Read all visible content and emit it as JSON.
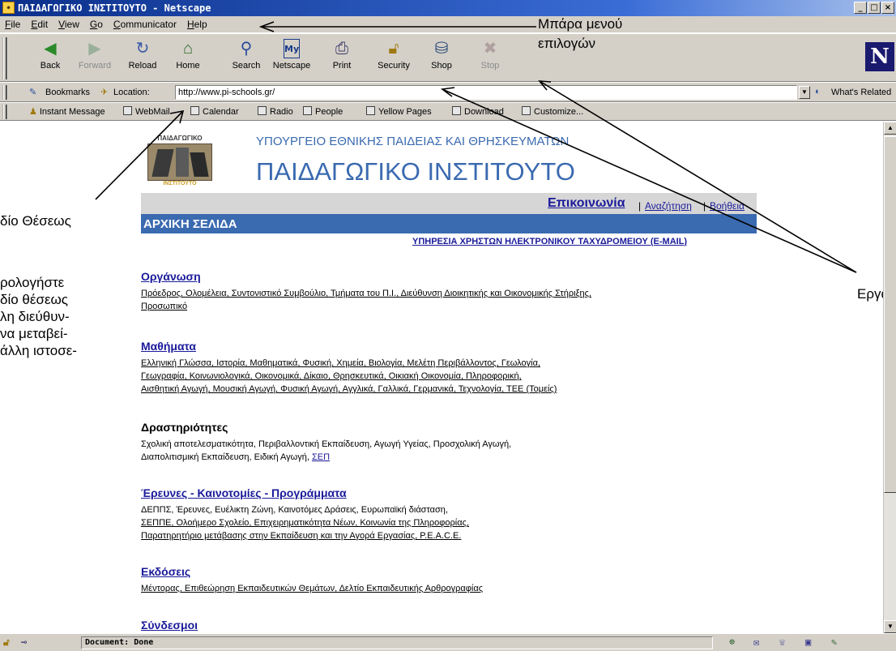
{
  "window": {
    "title": "ΠΑΙΔΑΓΩΓΙΚΟ ΙΝΣΤΙΤΟΥΤΟ - Netscape",
    "controls": [
      "_",
      "□",
      "×"
    ]
  },
  "menubar": [
    "File",
    "Edit",
    "View",
    "Go",
    "Communicator",
    "Help"
  ],
  "toolbar": {
    "buttons": [
      {
        "label": "Back",
        "icon": "back-arrow-icon",
        "enabled": true
      },
      {
        "label": "Forward",
        "icon": "forward-arrow-icon",
        "enabled": false
      },
      {
        "label": "Reload",
        "icon": "reload-icon",
        "enabled": true
      },
      {
        "label": "Home",
        "icon": "home-icon",
        "enabled": true
      },
      {
        "label": "Search",
        "icon": "search-icon",
        "enabled": true
      },
      {
        "label": "Netscape",
        "icon": "my-netscape-icon",
        "enabled": true
      },
      {
        "label": "Print",
        "icon": "print-icon",
        "enabled": true
      },
      {
        "label": "Security",
        "icon": "lock-icon",
        "enabled": true
      },
      {
        "label": "Shop",
        "icon": "shop-bag-icon",
        "enabled": true
      },
      {
        "label": "Stop",
        "icon": "stop-icon",
        "enabled": false
      }
    ],
    "logo": "N"
  },
  "location_bar": {
    "bookmarks_label": "Bookmarks",
    "location_label": "Location:",
    "url": "http://www.pi-schools.gr/",
    "whats_related": "What's Related"
  },
  "personal_bar": [
    "Instant Message",
    "WebMail",
    "Calendar",
    "Radio",
    "People",
    "Yellow Pages",
    "Download",
    "Customize..."
  ],
  "page": {
    "logo_text": "ΠΑΙΔΑΓΩΓΙΚΟ",
    "logo_bottom": "ΙΝΣΤΙΤΟΥΤΟ",
    "ministry": "ΥΠΟΥΡΓΕΙΟ ΕΘΝΙΚΗΣ ΠΑΙΔΕΙΑΣ ΚΑΙ ΘΡΗΣΚΕΥΜΑΤΩΝ",
    "institute": "ΠΑΙΔΑΓΩΓΙΚΟ ΙΝΣΤΙΤΟΥΤΟ",
    "top_links": {
      "contact": "Επικοινωνία",
      "search": "Αναζήτηση",
      "help": "Βοήθεια",
      "sep": "|"
    },
    "home_bar": "ΑΡΧΙΚΗ ΣΕΛΙΔΑ",
    "email_link": "ΥΠΗΡΕΣΙΑ ΧΡΗΣΤΩΝ ΗΛΕΚΤΡΟΝΙΚΟΥ ΤΑΧΥΔΡΟΜΕΙΟΥ (E-MAIL)",
    "sections": [
      {
        "title": "Οργάνωση",
        "lines": [
          "Πρόεδρος, Ολομέλεια, Συντονιστικό Συμβούλιο, Τμήματα του Π.Ι., Διεύθυνση Διοικητικής και Οικονομικής Στήριξης,",
          "Προσωπικό"
        ]
      },
      {
        "title": "Μαθήματα",
        "lines": [
          "Ελληνική Γλώσσα, Ιστορία, Μαθηματικά, Φυσική, Χημεία, Βιολογία, Μελέτη Περιβάλλοντος, Γεωλογία,",
          "Γεωγραφία, Κοινωνιολογικά, Οικονομικά, Δίκαιο, Θρησκευτικά, Οικιακή Οικονομία, Πληροφορική,",
          "Αισθητική Αγωγή, Μουσική Αγωγή, Φυσική Αγωγή, Αγγλικά, Γαλλικά, Γερμανικά, Τεχνολογία, ΤΕΕ (Τομείς)"
        ]
      },
      {
        "title": "Δραστηριότητες",
        "lines": [
          "Σχολική αποτελεσματικότητα, Περιβαλλοντική Εκπαίδευση, Αγωγή Υγείας, Προσχολική Αγωγή,",
          "Διαπολιτισμική Εκπαίδευση, Ειδική Αγωγή, ",
          "ΣΕΠ"
        ]
      },
      {
        "title": "Έρευνες - Καινοτομίες - Προγράμματα",
        "lines": [
          "ΔΕΠΠΣ, Έρευνες, Ευέλικτη Ζώνη, Καινοτόμες Δράσεις, Ευρωπαϊκή διάσταση,",
          "ΣΕΠΠΕ, Ολοήμερο Σχολείο, Επιχειρηματικότητα Νέων, Κοινωνία της Πληροφορίας,",
          "Παρατηρητήριο μετάβασης στην Εκπαίδευση και την Αγορά Εργασίας, P.E.A.C.E."
        ]
      },
      {
        "title": "Εκδόσεις",
        "lines": [
          "Μέντορας, Επιθεώρηση Εκπαιδευτικών Θεμάτων, Δελτίο Εκπαιδευτικής Αρθρογραφίας"
        ]
      },
      {
        "title": "Σύνδεσμοι",
        "lines": []
      }
    ]
  },
  "status": {
    "text": "Document: Done"
  },
  "annotations": {
    "menu": [
      "Μπάρα μενού",
      "επιλογών"
    ],
    "location": "δίο Θέσεως",
    "left_paragraph": [
      "ρολογήστε",
      "δίο θέσεως",
      "λη διεύθυν-",
      "να μεταβεί-",
      "άλλη ιστοσε-"
    ],
    "toolbar": "Εργα"
  }
}
